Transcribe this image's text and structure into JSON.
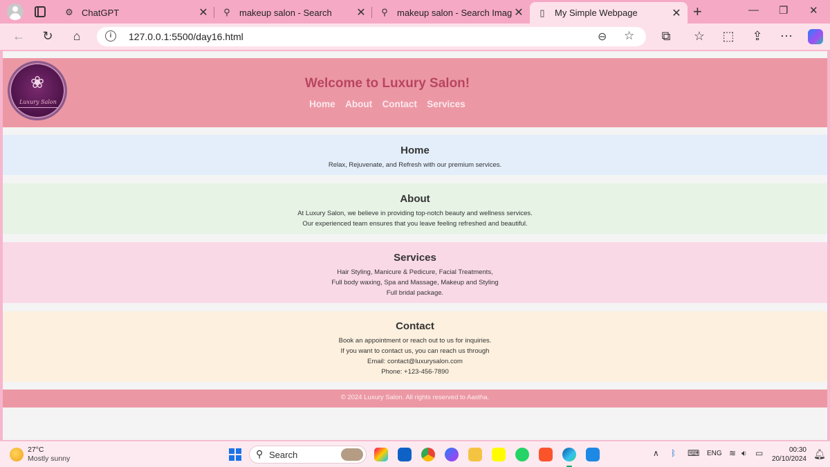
{
  "browser": {
    "tabs": [
      {
        "title": "ChatGPT",
        "icon": "chatgpt-icon",
        "glyph": "⚙"
      },
      {
        "title": "makeup salon - Search",
        "icon": "search-icon",
        "glyph": "🔍"
      },
      {
        "title": "makeup salon - Search Images",
        "icon": "search-icon",
        "glyph": "🔍"
      },
      {
        "title": "My Simple Webpage",
        "icon": "page-icon",
        "glyph": "🗋"
      }
    ],
    "active_tab": 3,
    "url": "127.0.0.1:5500/day16.html"
  },
  "site": {
    "logo_text": "Luxury Salon",
    "title": "Welcome to Luxury Salon!",
    "nav": [
      "Home",
      "About",
      "Contact",
      "Services"
    ],
    "sections": {
      "home": {
        "heading": "Home",
        "lines": [
          "Relax, Rejuvenate, and Refresh with our premium services."
        ]
      },
      "about": {
        "heading": "About",
        "lines": [
          "At Luxury Salon, we believe in providing top-notch beauty and wellness services.",
          "Our experienced team ensures that you leave feeling refreshed and beautiful."
        ]
      },
      "services": {
        "heading": "Services",
        "lines": [
          "Hair Styling, Manicure & Pedicure, Facial Treatments,",
          "Full body waxing, Spa and Massage, Makeup and Styling",
          "Full bridal package."
        ]
      },
      "contact": {
        "heading": "Contact",
        "lines": [
          "Book an appointment or reach out to us for inquiries.",
          "If you want to contact us, you can reach us through",
          "Email: contact@luxurysalon.com",
          "Phone: +123-456-7890"
        ]
      }
    },
    "footer": "© 2024 Luxury Salon. All rights reserved to Aastha."
  },
  "taskbar": {
    "weather_temp": "27°C",
    "weather_desc": "Mostly sunny",
    "search_label": "Search",
    "language": "ENG",
    "time": "00:30",
    "date": "20/10/2024"
  },
  "colors": {
    "tab_strip": "#f6a9c4",
    "header_bg": "#ec98a4",
    "title_color": "#b8455f",
    "home_bg": "#e3eefa",
    "about_bg": "#e6f3e5",
    "services_bg": "#fad9e6",
    "contact_bg": "#fdf0de"
  }
}
